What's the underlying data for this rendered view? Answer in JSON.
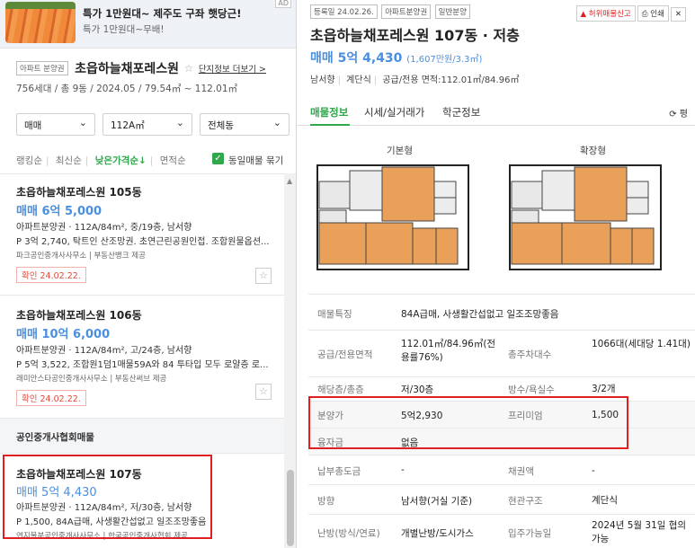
{
  "ad": {
    "title": "특가 1만원대~ 제주도 구좌 햇당근!",
    "subtitle": "특가 1만원대~무배!",
    "badge": "AD"
  },
  "complex": {
    "type_tag": "아파트 분양권",
    "name": "초읍하늘채포레스원",
    "more_link": "단지정보 더보기 >",
    "info": "756세대 / 총 9동 / 2024.05 / 79.54㎡ ~ 112.01㎡"
  },
  "filters": {
    "deal": "매매",
    "size": "112A㎡",
    "building": "전체동"
  },
  "sort": {
    "options": [
      "랭킹순",
      "최신순",
      "낮은가격순↓",
      "면적순"
    ],
    "active_index": 2,
    "same_listing_label": "동일매물 묶기",
    "same_listing_checked": true
  },
  "listings": [
    {
      "title": "초읍하늘채포레스원 105동",
      "price": "매매 6억 5,000",
      "spec": "아파트분양권 · 112A/84m², 중/19층, 남서향",
      "desc": "P 3억 2,740, 탁트인 산조망권. 초연근린공원인접. 조합원물옵션...",
      "agent": "파크공인중개사사무소 | 부동산뱅크 제공",
      "confirm": "확인 24.02.22."
    },
    {
      "title": "초읍하늘채포레스원 106동",
      "price": "매매 10억 6,000",
      "spec": "아파트분양권 · 112A/84m², 고/24층, 남서향",
      "desc": "P 5억 3,522, 조합원1덤1매물59A와 84 투타입 모두 로얄층 로...",
      "agent": "래미안스타공인중개사사무소 | 부동산써브 제공",
      "confirm": "확인 24.02.22."
    },
    {
      "title": "초읍하늘채포레스원 107동",
      "price": "매매 5억 4,430",
      "spec": "아파트분양권 · 112A/84m², 저/30층, 남서향",
      "desc": "P 1,500, 84A급매, 사생활간섭없고 일조조망좋음",
      "agent": "연지불분공인중개사사무소 | 한국공인중개사협회 제공"
    }
  ],
  "section_head": "공인중개사협회매물",
  "detail": {
    "tags": [
      "등록일 24.02.26.",
      "아파트분양권",
      "일반분양"
    ],
    "report_btn": "허위매물신고",
    "print_btn": "인쇄",
    "title": "초읍하늘채포레스원 107동 · 저층",
    "price": "매매 5억 4,430",
    "price_per": "(1,607만원/3.3㎡)",
    "meta": [
      "남서향",
      "계단식",
      "공급/전용 면적:112.01㎡/84.96㎡"
    ],
    "tabs": [
      "매물정보",
      "시세/실거래가",
      "학군정보"
    ],
    "active_tab": 0,
    "refresh": "평",
    "plan_labels": [
      "기본형",
      "확장형"
    ],
    "rows": [
      {
        "k": "매물특징",
        "v": "84A급매, 사생활간섭없고 일조조망좋음"
      },
      {
        "k": "공급/전용면적",
        "v": "112.01㎡/84.96㎡(전용률76%)",
        "k2": "총주차대수",
        "v2": "1066대(세대당 1.41대)"
      },
      {
        "k": "해당층/총층",
        "v": "저/30층",
        "k2": "방수/욕실수",
        "v2": "3/2개"
      },
      {
        "k": "분양가",
        "v": "5억2,930",
        "k2": "프리미엄",
        "v2": "1,500"
      },
      {
        "k": "융자금",
        "v": "없음"
      },
      {
        "k": "납부총도금",
        "v": "-",
        "k2": "채권액",
        "v2": "-"
      },
      {
        "k": "방향",
        "v": "남서향(거실 기준)",
        "k2": "현관구조",
        "v2": "계단식"
      },
      {
        "k": "난방(방식/연료)",
        "v": "개별난방/도시가스",
        "k2": "입주가능일",
        "v2": "2024년 5월 31일 협의가능"
      }
    ]
  }
}
